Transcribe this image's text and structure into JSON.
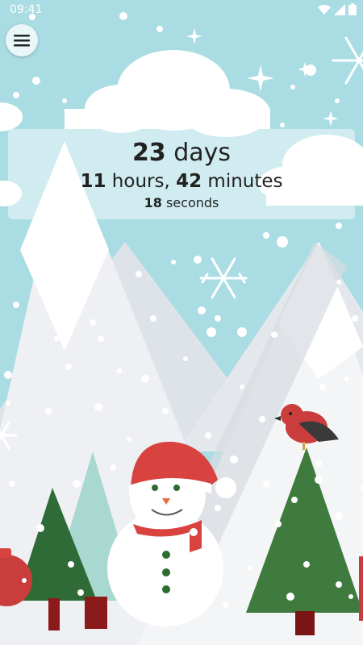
{
  "status_bar": {
    "time": "09:41"
  },
  "countdown": {
    "days_value": "23",
    "days_unit": "days",
    "hours_value": "11",
    "hours_unit": "hours,",
    "minutes_value": "42",
    "minutes_unit": "minutes",
    "seconds_value": "18",
    "seconds_unit": "seconds"
  },
  "menu": {
    "icon": "hamburger-menu-icon"
  },
  "colors": {
    "sky": "#a9dde3",
    "mountain": "#f4f6f8",
    "tree_dark": "#3f6e3b",
    "tree_light": "#a8d8cf",
    "red": "#d84340"
  }
}
